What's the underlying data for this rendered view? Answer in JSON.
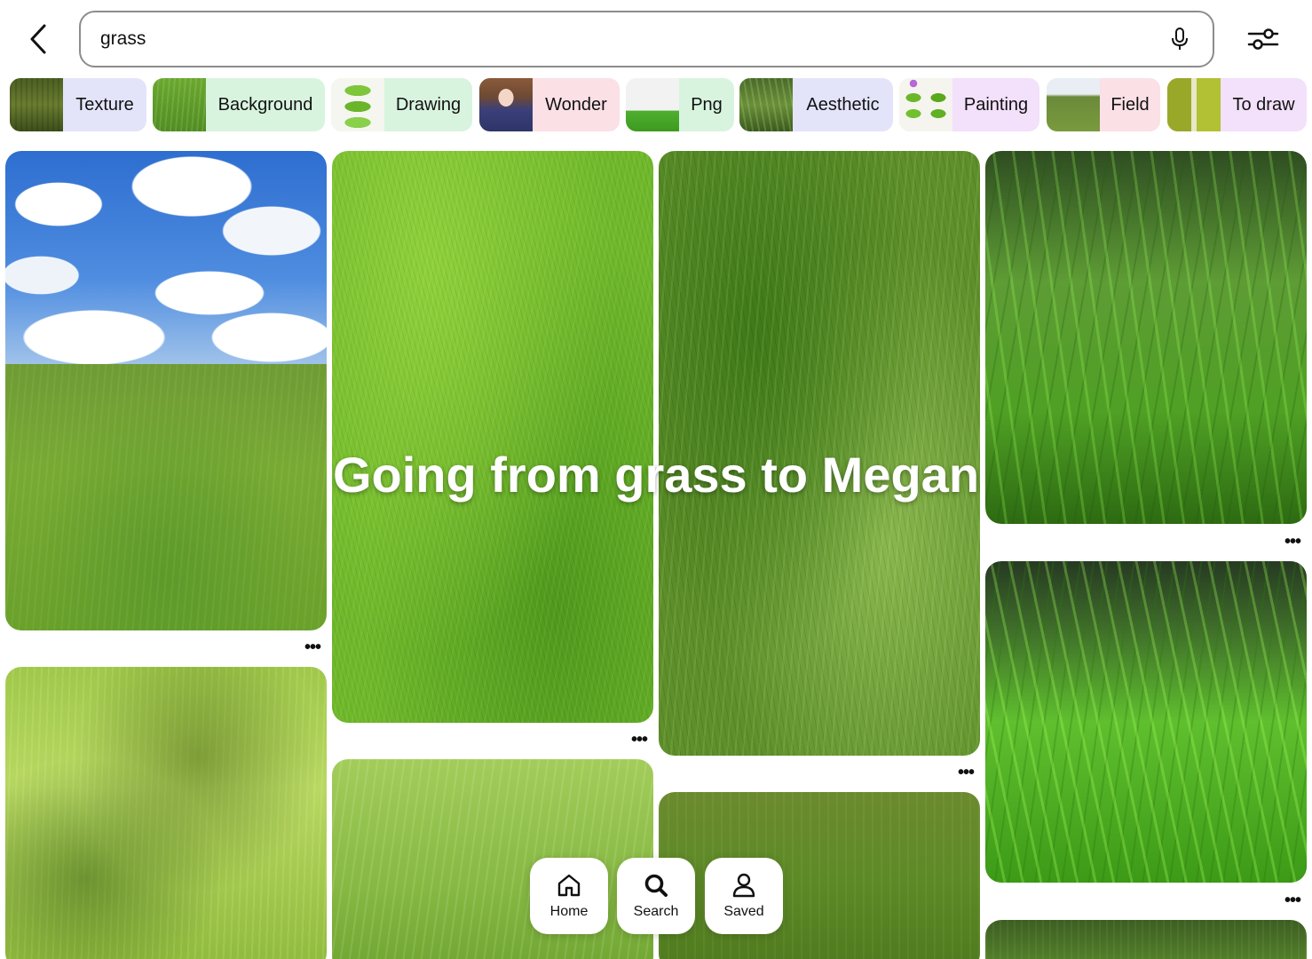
{
  "search": {
    "query": "grass"
  },
  "chips": [
    {
      "label": "Texture",
      "bg": "#e3e4fa"
    },
    {
      "label": "Background",
      "bg": "#d8f4df"
    },
    {
      "label": "Drawing",
      "bg": "#d8f4df"
    },
    {
      "label": "Wonder",
      "bg": "#fbe0e6"
    },
    {
      "label": "Png",
      "bg": "#d8f4df"
    },
    {
      "label": "Aesthetic",
      "bg": "#e3e4fa"
    },
    {
      "label": "Painting",
      "bg": "#f3e0fa"
    },
    {
      "label": "Field",
      "bg": "#fbe0e6"
    },
    {
      "label": "To draw",
      "bg": "#f3e0fa"
    }
  ],
  "overlay": {
    "caption": "Going from grass to Megan"
  },
  "nav": {
    "home": "Home",
    "search": "Search",
    "saved": "Saved"
  },
  "icons": {
    "back": "chevron-left-icon",
    "mic": "microphone-icon",
    "filter": "filter-sliders-icon",
    "more": "more-options-icon"
  },
  "more_label": "•••"
}
